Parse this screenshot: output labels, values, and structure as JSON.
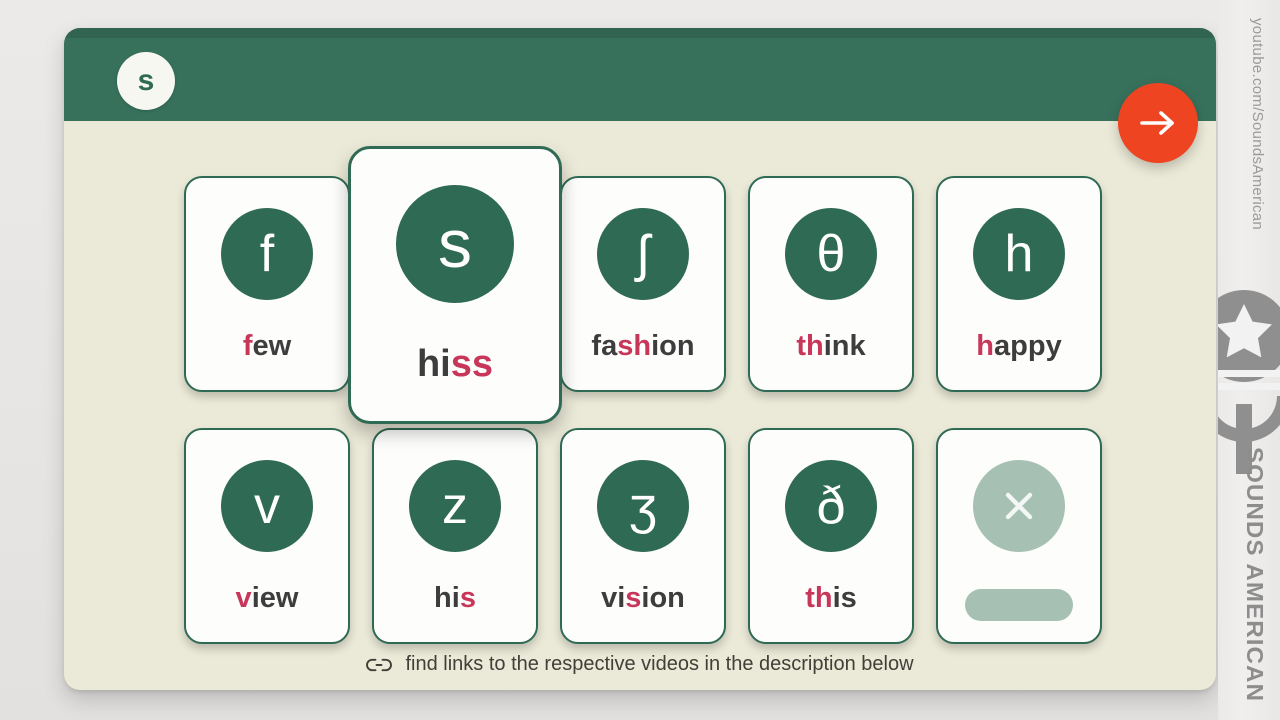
{
  "header": {
    "sound_symbol": "s",
    "next_button_icon": "arrow-right-icon"
  },
  "cards": [
    {
      "symbol": "f",
      "word_prefix": "",
      "word_highlight": "f",
      "word_suffix": "ew",
      "state": "normal",
      "row": 1,
      "col": 1
    },
    {
      "symbol": "s",
      "word_prefix": "hi",
      "word_highlight": "ss",
      "word_suffix": "",
      "state": "selected",
      "row": 1,
      "col": 2
    },
    {
      "symbol": "ʃ",
      "word_prefix": "fa",
      "word_highlight": "sh",
      "word_suffix": "ion",
      "state": "normal",
      "row": 1,
      "col": 3
    },
    {
      "symbol": "θ",
      "word_prefix": "",
      "word_highlight": "th",
      "word_suffix": "ink",
      "state": "normal",
      "row": 1,
      "col": 4
    },
    {
      "symbol": "h",
      "word_prefix": "",
      "word_highlight": "h",
      "word_suffix": "appy",
      "state": "normal",
      "row": 1,
      "col": 5
    },
    {
      "symbol": "v",
      "word_prefix": "",
      "word_highlight": "v",
      "word_suffix": "iew",
      "state": "normal",
      "row": 2,
      "col": 1
    },
    {
      "symbol": "z",
      "word_prefix": "hi",
      "word_highlight": "s",
      "word_suffix": "",
      "state": "normal",
      "row": 2,
      "col": 2
    },
    {
      "symbol": "ʒ",
      "word_prefix": "vi",
      "word_highlight": "s",
      "word_suffix": "ion",
      "state": "normal",
      "row": 2,
      "col": 3
    },
    {
      "symbol": "ð",
      "word_prefix": "",
      "word_highlight": "th",
      "word_suffix": "is",
      "state": "normal",
      "row": 2,
      "col": 4
    },
    {
      "symbol": "×",
      "word_prefix": "",
      "word_highlight": "",
      "word_suffix": "",
      "state": "locked",
      "row": 2,
      "col": 5
    }
  ],
  "footer": {
    "icon": "link-icon",
    "text": "find links to the respective videos in the description below"
  },
  "rail": {
    "url": "youtube.com/SoundsAmerican",
    "wordmark": "SOUNDS AMERICAN",
    "logo_icon": "microphone-star-logo"
  },
  "colors": {
    "brand_green": "#2f6a54",
    "header_green": "#37715c",
    "panel_cream": "#ebe9d7",
    "accent_red": "#ee4422",
    "highlight_crimson": "#c8365a",
    "disabled_green": "#a6c1b3",
    "page_gray": "#e9e7e5"
  }
}
